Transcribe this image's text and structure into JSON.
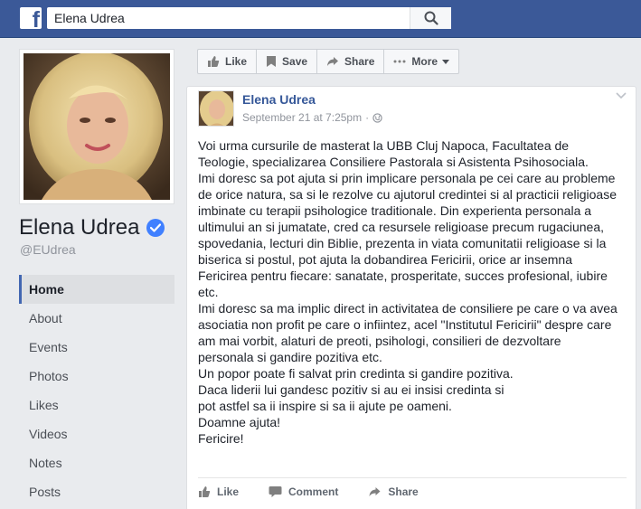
{
  "search": {
    "value": "Elena Udrea"
  },
  "profile": {
    "name": "Elena Udrea",
    "handle": "@EUdrea"
  },
  "nav": [
    {
      "label": "Home",
      "active": true
    },
    {
      "label": "About"
    },
    {
      "label": "Events"
    },
    {
      "label": "Photos"
    },
    {
      "label": "Likes"
    },
    {
      "label": "Videos"
    },
    {
      "label": "Notes"
    },
    {
      "label": "Posts"
    }
  ],
  "page_actions": {
    "like": "Like",
    "save": "Save",
    "share": "Share",
    "more": "More"
  },
  "post": {
    "author": "Elena Udrea",
    "timestamp": "September 21 at 7:25pm",
    "lines": [
      "Voi urma cursurile de masterat la UBB Cluj Napoca, Facultatea de",
      "Teologie, specializarea Consiliere Pastorala si Asistenta Psihosociala.",
      "Imi doresc sa pot ajuta si prin implicare personala pe cei care au probleme",
      "de orice natura, sa si le rezolve cu ajutorul credintei si al practicii religioase",
      "imbinate cu terapii psihologice traditionale. Din experienta personala a",
      "ultimului an si jumatate, cred ca resursele religioase precum rugaciunea,",
      "spovedania, lecturi din Biblie, prezenta in viata comunitatii religioase si la",
      "biserica si postul, pot ajuta la dobandirea Fericirii, orice ar insemna",
      "Fericirea pentru fiecare: sanatate, prosperitate, succes profesional, iubire",
      "etc.",
      "Imi doresc sa ma implic direct in activitatea de consiliere pe care o va avea",
      "asociatia non profit pe care o infiintez, acel \"Institutul Fericirii\" despre care",
      "am mai vorbit, alaturi de preoti, psihologi, consilieri de dezvoltare",
      "personala si gandire pozitiva etc.",
      "Un popor poate fi salvat prin credinta si gandire pozitiva.",
      "Daca liderii lui gandesc pozitiv si au ei insisi credinta si",
      "pot astfel sa ii inspire si sa ii ajute pe oameni.",
      "Doamne ajuta!",
      "Fericire!"
    ],
    "actions": {
      "like": "Like",
      "comment": "Comment",
      "share": "Share"
    }
  },
  "colors": {
    "topbar": "#3b5998",
    "link": "#365899",
    "verified": "#4080ff",
    "background": "#e9ebee"
  }
}
